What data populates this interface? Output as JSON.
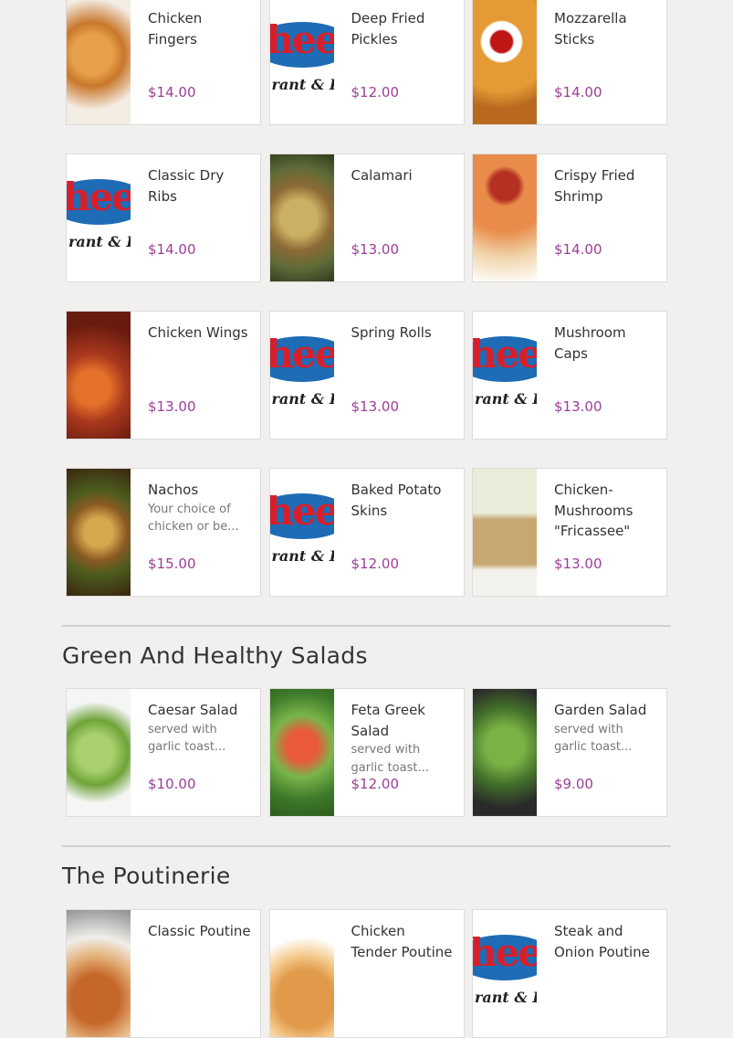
{
  "rows": [
    [
      {
        "name": "Chicken Fingers",
        "price": "$14.00",
        "desc": "",
        "img": "food-fingers"
      },
      {
        "name": "Deep Fried Pickles",
        "price": "$12.00",
        "desc": "",
        "img": "logo"
      },
      {
        "name": "Mozzarella Sticks",
        "price": "$14.00",
        "desc": "",
        "img": "food-mozz"
      }
    ],
    [
      {
        "name": "Classic Dry Ribs",
        "price": "$14.00",
        "desc": "",
        "img": "logo"
      },
      {
        "name": "Calamari",
        "price": "$13.00",
        "desc": "",
        "img": "food-calamari"
      },
      {
        "name": "Crispy Fried Shrimp",
        "price": "$14.00",
        "desc": "",
        "img": "food-shrimp"
      }
    ],
    [
      {
        "name": "Chicken Wings",
        "price": "$13.00",
        "desc": "",
        "img": "food-wings"
      },
      {
        "name": "Spring Rolls",
        "price": "$13.00",
        "desc": "",
        "img": "logo"
      },
      {
        "name": "Mushroom Caps",
        "price": "$13.00",
        "desc": "",
        "img": "logo"
      }
    ],
    [
      {
        "name": "Nachos",
        "price": "$15.00",
        "desc": "Your choice of chicken or be...",
        "img": "food-nachos"
      },
      {
        "name": "Baked Potato Skins",
        "price": "$12.00",
        "desc": "",
        "img": "logo"
      },
      {
        "name": "Chicken-Mushrooms \"Fricassee\"",
        "price": "$13.00",
        "desc": "",
        "img": "food-fricassee"
      }
    ]
  ],
  "logo": {
    "text": "hee",
    "sub": "rant & I"
  },
  "salads": {
    "title": "Green And Healthy Salads",
    "items": [
      {
        "name": "Caesar Salad",
        "price": "$10.00",
        "desc": "served with garlic toast...",
        "img": "food-caesar"
      },
      {
        "name": "Feta Greek Salad",
        "price": "$12.00",
        "desc": "served with garlic toast...",
        "img": "food-feta"
      },
      {
        "name": "Garden Salad",
        "price": "$9.00",
        "desc": "served with garlic toast...",
        "img": "food-garden"
      }
    ]
  },
  "poutinerie": {
    "title": "The Poutinerie",
    "items": [
      {
        "name": "Classic Poutine",
        "img": "food-poutine"
      },
      {
        "name": "Chicken Tender Poutine",
        "img": "food-tender"
      },
      {
        "name": "Steak and Onion Poutine",
        "img": "logo"
      }
    ]
  },
  "colors": {
    "price": "#9b3f96",
    "background": "#f1f0ef",
    "divider": "#cfcfcf"
  }
}
